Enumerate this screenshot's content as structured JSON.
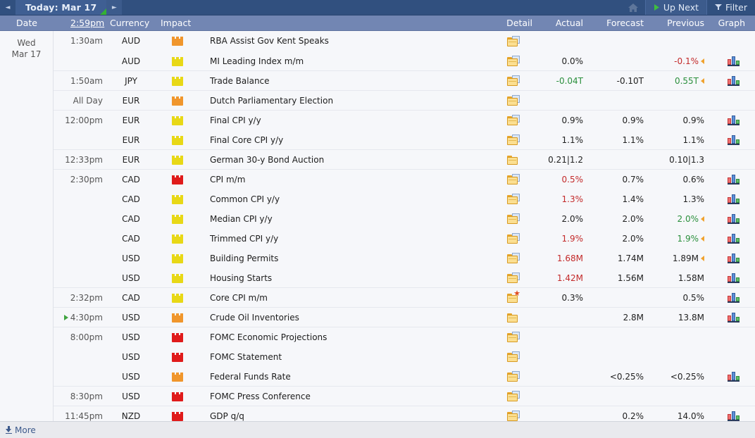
{
  "topbar": {
    "prev_label": "◄",
    "next_label": "►",
    "today_label": "Today: Mar 17",
    "up_next_label": "Up Next",
    "filter_label": "Filter",
    "home_icon": "home-icon",
    "accent_blue": "#31507f",
    "tab_blue": "#3f5f93",
    "green_mark": "#34b233"
  },
  "columns": {
    "date": "Date",
    "time": "2:59pm",
    "currency": "Currency",
    "impact": "Impact",
    "event": "",
    "detail": "Detail",
    "actual": "Actual",
    "forecast": "Forecast",
    "previous": "Previous",
    "graph": "Graph"
  },
  "day": {
    "weekday": "Wed",
    "date": "Mar 17"
  },
  "footer": {
    "more_label": "More",
    "more_icon": "download-icon"
  },
  "rows": [
    {
      "time": "1:30am",
      "next": false,
      "currency": "AUD",
      "impact": "orange",
      "event": "RBA Assist Gov Kent Speaks",
      "detail": "folder-stack-icon",
      "actual": "",
      "actual_color": "black",
      "forecast": "",
      "previous": "",
      "previous_color": "black",
      "revised": false,
      "graph": false,
      "sep": true
    },
    {
      "time": "",
      "next": false,
      "currency": "AUD",
      "impact": "yellow",
      "event": "MI Leading Index m/m",
      "detail": "folder-stack-icon",
      "actual": "0.0%",
      "actual_color": "black",
      "forecast": "",
      "previous": "-0.1%",
      "previous_color": "red",
      "revised": true,
      "graph": true,
      "sep": false
    },
    {
      "time": "1:50am",
      "next": false,
      "currency": "JPY",
      "impact": "yellow",
      "event": "Trade Balance",
      "detail": "folder-stack-icon",
      "actual": "-0.04T",
      "actual_color": "green",
      "forecast": "-0.10T",
      "previous": "0.55T",
      "previous_color": "green",
      "revised": true,
      "graph": true,
      "sep": true
    },
    {
      "time": "All Day",
      "next": false,
      "currency": "EUR",
      "impact": "orange",
      "event": "Dutch Parliamentary Election",
      "detail": "folder-stack-icon",
      "actual": "",
      "actual_color": "black",
      "forecast": "",
      "previous": "",
      "previous_color": "black",
      "revised": false,
      "graph": false,
      "sep": true
    },
    {
      "time": "12:00pm",
      "next": false,
      "currency": "EUR",
      "impact": "yellow",
      "event": "Final CPI y/y",
      "detail": "folder-stack-icon",
      "actual": "0.9%",
      "actual_color": "black",
      "forecast": "0.9%",
      "previous": "0.9%",
      "previous_color": "black",
      "revised": false,
      "graph": true,
      "sep": true
    },
    {
      "time": "",
      "next": false,
      "currency": "EUR",
      "impact": "yellow",
      "event": "Final Core CPI y/y",
      "detail": "folder-stack-icon",
      "actual": "1.1%",
      "actual_color": "black",
      "forecast": "1.1%",
      "previous": "1.1%",
      "previous_color": "black",
      "revised": false,
      "graph": true,
      "sep": false
    },
    {
      "time": "12:33pm",
      "next": false,
      "currency": "EUR",
      "impact": "yellow",
      "event": "German 30-y Bond Auction",
      "detail": "folder-icon",
      "actual": "0.21|1.2",
      "actual_color": "black",
      "forecast": "",
      "previous": "0.10|1.3",
      "previous_color": "black",
      "revised": false,
      "graph": false,
      "sep": true
    },
    {
      "time": "2:30pm",
      "next": false,
      "currency": "CAD",
      "impact": "red",
      "event": "CPI m/m",
      "detail": "folder-stack-icon",
      "actual": "0.5%",
      "actual_color": "red",
      "forecast": "0.7%",
      "previous": "0.6%",
      "previous_color": "black",
      "revised": false,
      "graph": true,
      "sep": true
    },
    {
      "time": "",
      "next": false,
      "currency": "CAD",
      "impact": "yellow",
      "event": "Common CPI y/y",
      "detail": "folder-stack-icon",
      "actual": "1.3%",
      "actual_color": "red",
      "forecast": "1.4%",
      "previous": "1.3%",
      "previous_color": "black",
      "revised": false,
      "graph": true,
      "sep": false
    },
    {
      "time": "",
      "next": false,
      "currency": "CAD",
      "impact": "yellow",
      "event": "Median CPI y/y",
      "detail": "folder-stack-icon",
      "actual": "2.0%",
      "actual_color": "black",
      "forecast": "2.0%",
      "previous": "2.0%",
      "previous_color": "green",
      "revised": true,
      "graph": true,
      "sep": false
    },
    {
      "time": "",
      "next": false,
      "currency": "CAD",
      "impact": "yellow",
      "event": "Trimmed CPI y/y",
      "detail": "folder-stack-icon",
      "actual": "1.9%",
      "actual_color": "red",
      "forecast": "2.0%",
      "previous": "1.9%",
      "previous_color": "green",
      "revised": true,
      "graph": true,
      "sep": false
    },
    {
      "time": "",
      "next": false,
      "currency": "USD",
      "impact": "yellow",
      "event": "Building Permits",
      "detail": "folder-stack-icon",
      "actual": "1.68M",
      "actual_color": "red",
      "forecast": "1.74M",
      "previous": "1.89M",
      "previous_color": "black",
      "revised": true,
      "graph": true,
      "sep": false
    },
    {
      "time": "",
      "next": false,
      "currency": "USD",
      "impact": "yellow",
      "event": "Housing Starts",
      "detail": "folder-stack-icon",
      "actual": "1.42M",
      "actual_color": "red",
      "forecast": "1.56M",
      "previous": "1.58M",
      "previous_color": "black",
      "revised": false,
      "graph": true,
      "sep": false
    },
    {
      "time": "2:32pm",
      "next": false,
      "currency": "CAD",
      "impact": "yellow",
      "event": "Core CPI m/m",
      "detail": "folder-star-icon",
      "actual": "0.3%",
      "actual_color": "black",
      "forecast": "",
      "previous": "0.5%",
      "previous_color": "black",
      "revised": false,
      "graph": true,
      "sep": true
    },
    {
      "time": "4:30pm",
      "next": true,
      "currency": "USD",
      "impact": "orange",
      "event": "Crude Oil Inventories",
      "detail": "folder-icon",
      "actual": "",
      "actual_color": "black",
      "forecast": "2.8M",
      "previous": "13.8M",
      "previous_color": "black",
      "revised": false,
      "graph": true,
      "sep": true
    },
    {
      "time": "8:00pm",
      "next": false,
      "currency": "USD",
      "impact": "red",
      "event": "FOMC Economic Projections",
      "detail": "folder-stack-icon",
      "actual": "",
      "actual_color": "black",
      "forecast": "",
      "previous": "",
      "previous_color": "black",
      "revised": false,
      "graph": false,
      "sep": true
    },
    {
      "time": "",
      "next": false,
      "currency": "USD",
      "impact": "red",
      "event": "FOMC Statement",
      "detail": "folder-stack-icon",
      "actual": "",
      "actual_color": "black",
      "forecast": "",
      "previous": "",
      "previous_color": "black",
      "revised": false,
      "graph": false,
      "sep": false
    },
    {
      "time": "",
      "next": false,
      "currency": "USD",
      "impact": "orange",
      "event": "Federal Funds Rate",
      "detail": "folder-stack-icon",
      "actual": "",
      "actual_color": "black",
      "forecast": "<0.25%",
      "previous": "<0.25%",
      "previous_color": "black",
      "revised": false,
      "graph": true,
      "sep": false
    },
    {
      "time": "8:30pm",
      "next": false,
      "currency": "USD",
      "impact": "red",
      "event": "FOMC Press Conference",
      "detail": "folder-stack-icon",
      "actual": "",
      "actual_color": "black",
      "forecast": "",
      "previous": "",
      "previous_color": "black",
      "revised": false,
      "graph": false,
      "sep": true
    },
    {
      "time": "11:45pm",
      "next": false,
      "currency": "NZD",
      "impact": "red",
      "event": "GDP q/q",
      "detail": "folder-stack-icon",
      "actual": "",
      "actual_color": "black",
      "forecast": "0.2%",
      "previous": "14.0%",
      "previous_color": "black",
      "revised": false,
      "graph": true,
      "sep": true
    }
  ]
}
